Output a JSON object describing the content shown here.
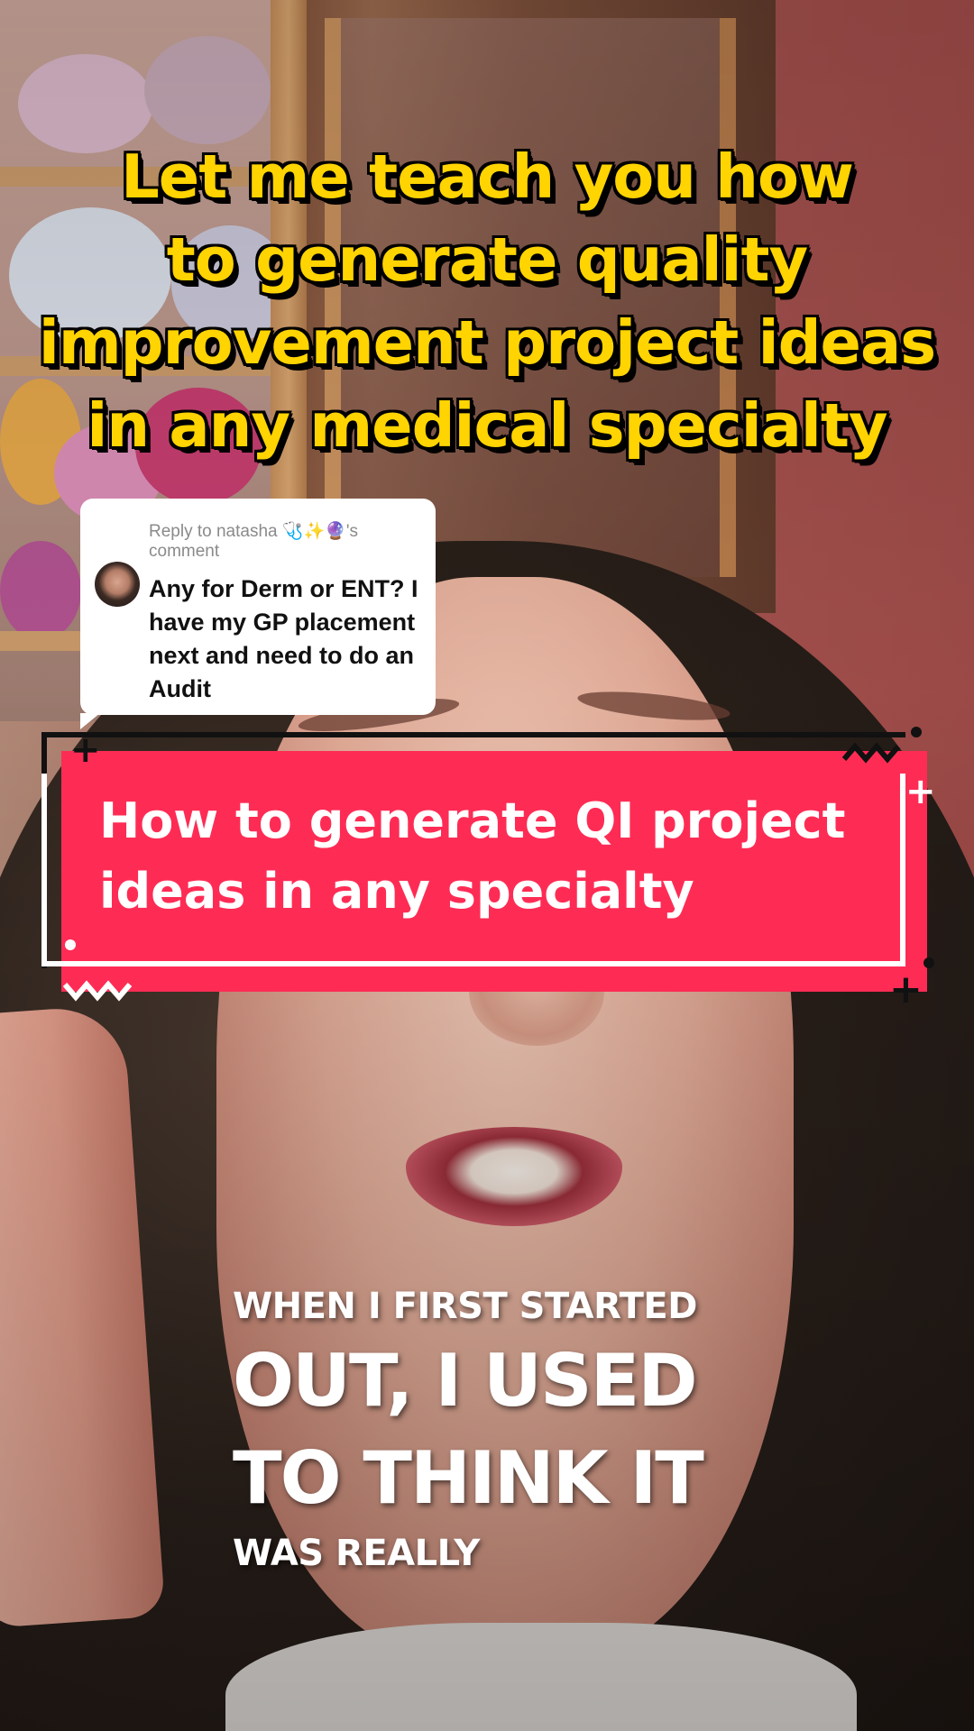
{
  "headline": {
    "lines": [
      "Let me teach you how",
      "to generate quality",
      "improvement project ideas",
      "in any medical specialty"
    ]
  },
  "reply": {
    "meta": "Reply to natasha 🩺✨🔮's comment",
    "text": "Any for Derm or ENT? I have my GP placement next and need to do an Audit"
  },
  "title_card": {
    "line1": "How to generate QI project",
    "line2": "ideas in any specialty"
  },
  "subtitles": {
    "line1": "WHEN I FIRST STARTED",
    "line2": "OUT, I USED",
    "line3": "TO THINK IT",
    "line4": "WAS REALLY"
  },
  "colors": {
    "headline_yellow": "#ffd400",
    "card_red": "#fe2c55",
    "subtitle_white": "#ffffff"
  }
}
